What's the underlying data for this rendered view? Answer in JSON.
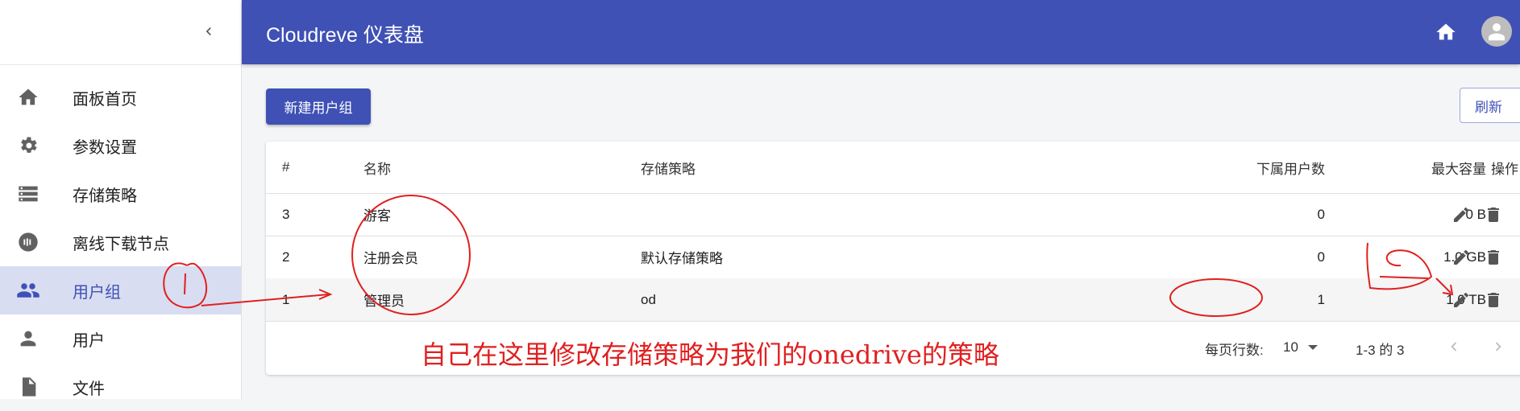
{
  "app": {
    "title": "Cloudreve 仪表盘"
  },
  "sidebar": {
    "items": [
      {
        "label": "面板首页",
        "icon": "home-icon"
      },
      {
        "label": "参数设置",
        "icon": "gear-icon"
      },
      {
        "label": "存储策略",
        "icon": "storage-icon"
      },
      {
        "label": "离线下载节点",
        "icon": "download-node-icon"
      },
      {
        "label": "用户组",
        "icon": "group-icon",
        "active": true
      },
      {
        "label": "用户",
        "icon": "person-icon"
      },
      {
        "label": "文件",
        "icon": "file-icon"
      }
    ]
  },
  "toolbar": {
    "new_group_label": "新建用户组",
    "refresh_label": "刷新"
  },
  "table": {
    "headers": {
      "id": "#",
      "name": "名称",
      "policy": "存储策略",
      "users": "下属用户数",
      "capacity": "最大容量",
      "actions": "操作"
    },
    "rows": [
      {
        "id": "3",
        "name": "游客",
        "policy": "",
        "users": "0",
        "capacity": "0 B"
      },
      {
        "id": "2",
        "name": "注册会员",
        "policy": "默认存储策略",
        "users": "0",
        "capacity": "1.0 GB"
      },
      {
        "id": "1",
        "name": "管理员",
        "policy": "od",
        "users": "1",
        "capacity": "1.0 TB"
      }
    ]
  },
  "pagination": {
    "rows_per_page_label": "每页行数:",
    "rows_per_page_value": "10",
    "range": "1-3 的 3"
  },
  "annotation": {
    "text": "自己在这里修改存储策略为我们的onedrive的策略"
  },
  "colors": {
    "primary": "#3f51b5",
    "active_bg": "#d9ddf1",
    "annotation": "#e02020"
  }
}
